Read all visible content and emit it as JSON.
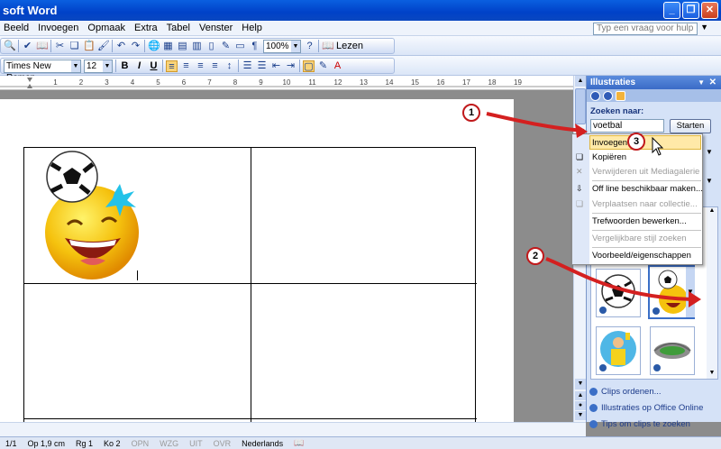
{
  "window": {
    "title": "soft Word"
  },
  "menu": [
    "Beeld",
    "Invoegen",
    "Opmaak",
    "Extra",
    "Tabel",
    "Venster",
    "Help"
  ],
  "help_placeholder": "Typ een vraag voor hulp",
  "toolbar": {
    "zoom": "100%",
    "read_label": "Lezen",
    "font": "Times New Roman",
    "size": "12",
    "bold": "B",
    "italic": "I",
    "underline": "U"
  },
  "ruler": {
    "marks": [
      "1",
      "2",
      "3",
      "4",
      "5",
      "6",
      "7",
      "8",
      "9",
      "10",
      "11",
      "12",
      "13",
      "14",
      "15",
      "16",
      "17",
      "18",
      "19"
    ]
  },
  "task_pane": {
    "title": "Illustraties",
    "search_label": "Zoeken naar:",
    "search_value": "voetbal",
    "go_button": "Starten",
    "links": [
      "Clips ordenen...",
      "Illustraties op Office Online",
      "Tips om clips te zoeken"
    ]
  },
  "context_menu": {
    "items": [
      {
        "label": "Invoegen",
        "disabled": false
      },
      {
        "label": "Kopiëren",
        "disabled": false
      },
      {
        "label": "Verwijderen uit Mediagalerie",
        "disabled": true
      },
      {
        "label": "Off line beschikbaar maken...",
        "disabled": false
      },
      {
        "label": "Verplaatsen naar collectie...",
        "disabled": true
      },
      {
        "label": "Trefwoorden bewerken...",
        "disabled": false
      },
      {
        "label": "Vergelijkbare stijl zoeken",
        "disabled": true
      },
      {
        "label": "Voorbeeld/eigenschappen",
        "disabled": false
      }
    ]
  },
  "callouts": [
    "1",
    "2",
    "3"
  ],
  "status": {
    "page": "1/1",
    "position": "Op 1,9 cm",
    "line": "Rg 1",
    "col": "Ko 2",
    "modes": [
      "OPN",
      "WZG",
      "UIT",
      "OVR"
    ],
    "language": "Nederlands"
  },
  "colors": {
    "callout_arrow": "#d42020",
    "highlight": "#ffe9a8",
    "titlebar": "#0a4fd6"
  }
}
